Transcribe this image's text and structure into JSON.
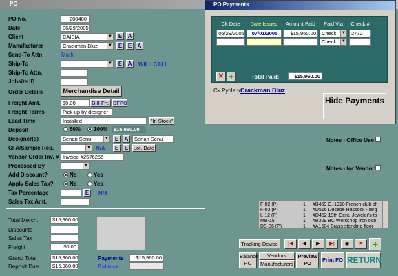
{
  "window": {
    "title": "PO"
  },
  "labels": {
    "po_no": "PO No.",
    "date": "Date",
    "client": "Client",
    "manufacturer": "Manufacturer",
    "send_to": "Send-To Attn.",
    "ship_to": "Ship-To",
    "ship_to_attn": "Ship-To Attn.",
    "jobsite": "Jobsite ID",
    "order_details": "Order Details",
    "freight_amt": "Freight Amt.",
    "freight_terms": "Freight Terms",
    "lead_time": "Lead Time",
    "deposit": "Deposit",
    "designers": "Designer(s)",
    "cfa": "CFA/Sample Req.",
    "vendor_inv": "Vendor Order Inv. #",
    "processed_by": "Processed By",
    "add_discount": "Add Discount?",
    "apply_tax": "Apply Sales Tax?",
    "tax_pct": "Tax Percentage",
    "sales_tax_amt": "Sales Tax Amt."
  },
  "values": {
    "po_no": "200480",
    "date": "06/29/2005",
    "client": "CAIBIA",
    "manufacturer": "Crackman Bluz",
    "send_to": "Mark",
    "freight_amt": "$0.00",
    "freight_terms": "Pick-up by designer",
    "lead_time": "Installed",
    "deposit_amt": "$15,960.00",
    "designer": "Senan Senu",
    "designer_2": "Senan Senu",
    "vendor_inv": "Invoice #2576256",
    "na": "N/A",
    "na2": "N/A"
  },
  "buttons": {
    "e": "E",
    "a": "A",
    "will_call": "WILL CALL",
    "merch_detail": "Merchandise Detail",
    "bill_frt": "Bill Frt.",
    "frt_po": "BFPO",
    "in_stock": "\"In Stock\"",
    "lot_date": "Lot, Date",
    "fifty": "50%",
    "hundred": "100%",
    "no": "No",
    "yes": "Yes"
  },
  "totals": {
    "total_merch_l": "Total Merch.",
    "total_merch": "$15,960.00",
    "discounts_l": "Discounts",
    "sales_tax_l": "Sales Tax",
    "freight_l": "Freight",
    "freight": "$0.00",
    "grand_total_l": "Grand Total",
    "grand_total": "$15,960.00",
    "deposit_due_l": "Deposit Due",
    "deposit_due": "$15,960.00",
    "payments_l": "Payments",
    "payments": "$15,960.00",
    "balance_l": "Balance",
    "balance": "--"
  },
  "notes": {
    "office": "Notes - Office Use",
    "vendor": "Notes - for Vendor"
  },
  "items": [
    {
      "c": "F-02 (P)",
      "q": "1",
      "d": "#B469 C. 1910 French club ch"
    },
    {
      "c": "F-03 (P)",
      "q": "1",
      "d": "#D516 Desede Hassock - larg"
    },
    {
      "c": "L-12 (P)",
      "q": "1",
      "d": "#D452 19th Cent. Jeweler's ta"
    },
    {
      "c": "MB-15",
      "q": "1",
      "d": "#B329 BC Workshop iron ocb"
    },
    {
      "c": "DS-06 (P)",
      "q": "1",
      "d": "#A1504 Brass standing floor"
    }
  ],
  "bottom": {
    "tracking": "Tracking Device",
    "balance_po": "Balance PO",
    "vendors": "Vendors",
    "manufacturers": "Manufacturers",
    "preview_po": "Preview PO",
    "print_po": "Print PO",
    "return": "RETURN",
    "first": "|◀",
    "prev": "◀",
    "next": "▶",
    "last": "▶|"
  },
  "popup": {
    "title": "PO Payments",
    "cols": [
      "Ck Date",
      "Date Issued",
      "Amount Paid",
      "Paid Via",
      "Check #"
    ],
    "row": {
      "ck_date": "06/29/2005",
      "date_issued": "07/01/2005",
      "amount": "$15,960.00",
      "via": "Check",
      "check": "2772"
    },
    "via2": "Check",
    "total_paid_l": "Total Paid:",
    "total_paid": "$15,960.00",
    "ck_payable_l": "Ck Pyble to:",
    "ck_payable": "Crackman Bluz",
    "hide": "Hide Payments"
  },
  "colors": {
    "bg": "#6e9690",
    "popup_bg": "#d4d0c8",
    "grid_bg": "#2c6a6a",
    "title": "#0a246a"
  }
}
